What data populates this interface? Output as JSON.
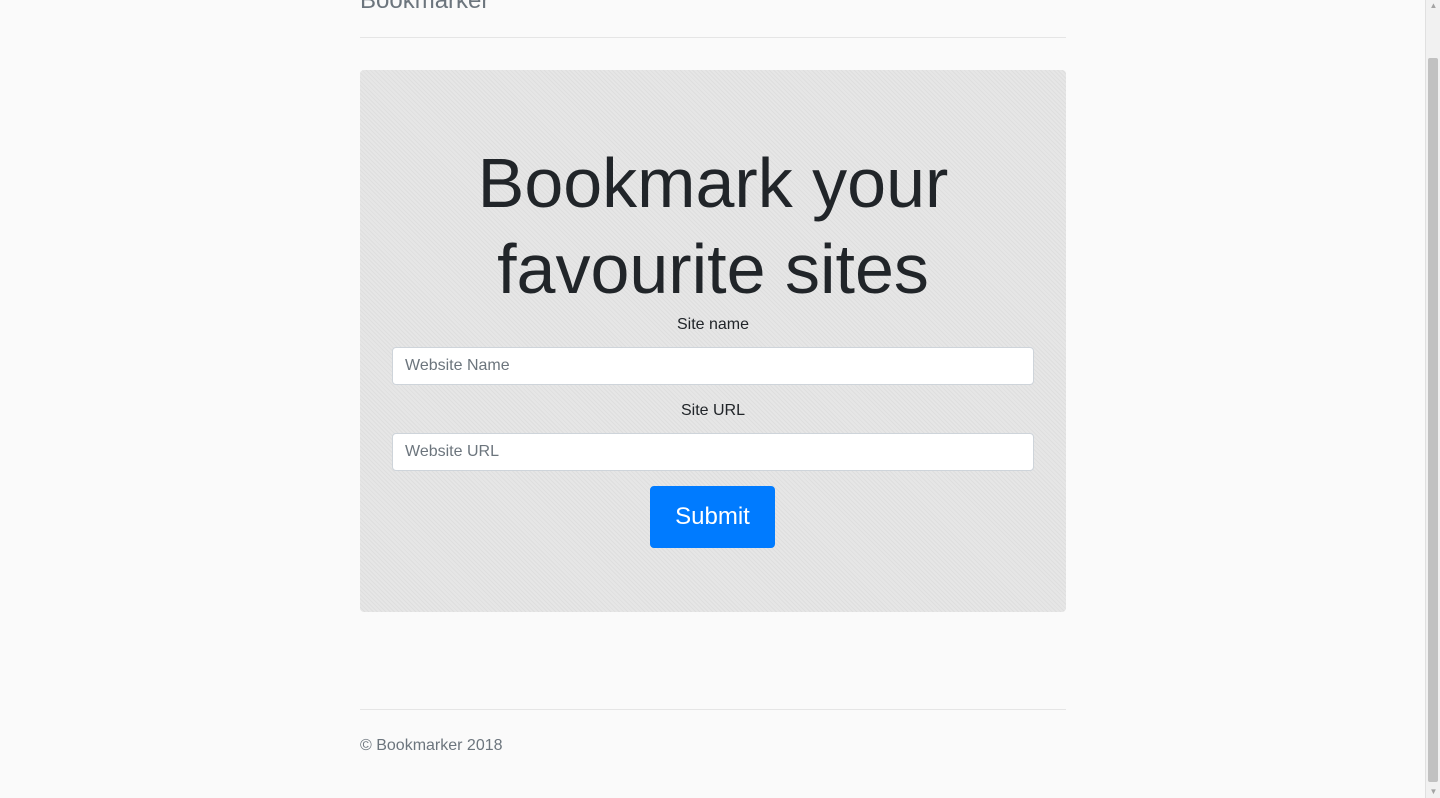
{
  "header": {
    "brand": "Bookmarker"
  },
  "hero": {
    "title": "Bookmark your favourite sites"
  },
  "form": {
    "site_name": {
      "label": "Site name",
      "placeholder": "Website Name",
      "value": ""
    },
    "site_url": {
      "label": "Site URL",
      "placeholder": "Website URL",
      "value": ""
    },
    "submit_label": "Submit"
  },
  "footer": {
    "copyright": "© Bookmarker 2018"
  },
  "scrollbar": {
    "up_arrow": "▲",
    "down_arrow": "▼"
  },
  "colors": {
    "accent": "#007bff",
    "jumbotron_bg": "#e6e6e6",
    "muted_text": "#6c757d",
    "page_bg": "#fafafa"
  }
}
